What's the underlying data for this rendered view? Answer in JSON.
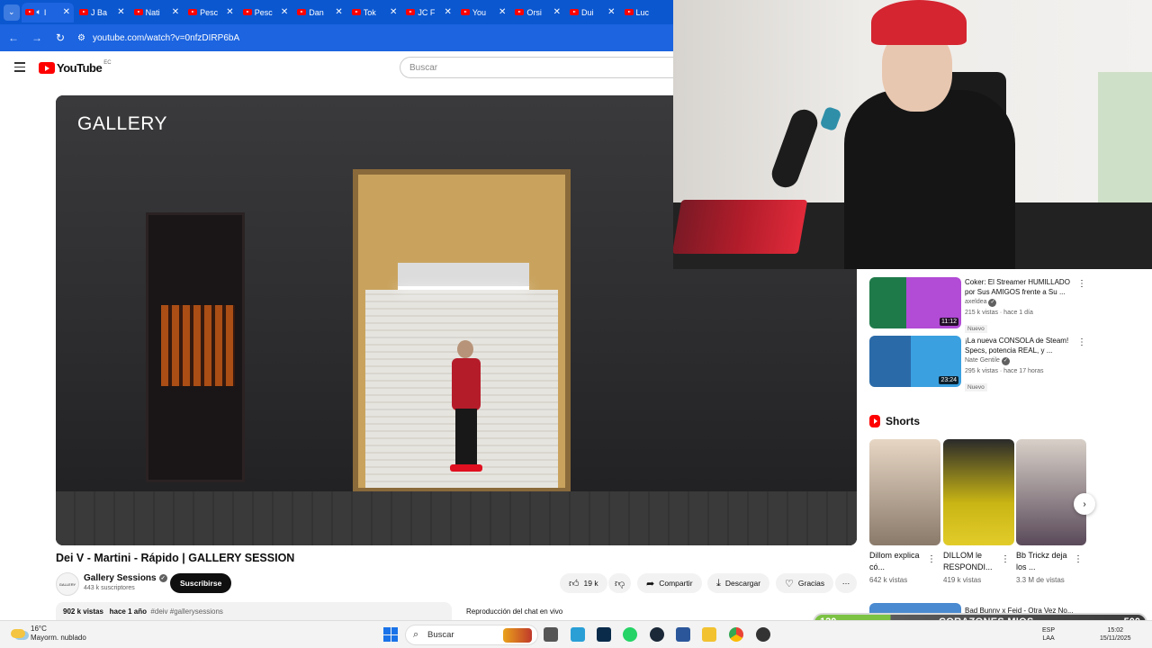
{
  "browser": {
    "tabs": [
      {
        "title": "I",
        "active": true,
        "audio": true
      },
      {
        "title": "J Ba"
      },
      {
        "title": "Nati"
      },
      {
        "title": "Pesc"
      },
      {
        "title": "Pesc"
      },
      {
        "title": "Dan"
      },
      {
        "title": "Tok"
      },
      {
        "title": "JC F"
      },
      {
        "title": "You"
      },
      {
        "title": "Orsi"
      },
      {
        "title": "Dui"
      },
      {
        "title": "Luc"
      }
    ],
    "url": "youtube.com/watch?v=0nfzDIRP6bA"
  },
  "youtube": {
    "logo_text": "YouTube",
    "country_code": "EC",
    "search_placeholder": "Buscar"
  },
  "video": {
    "watermark": "GALLERY",
    "title": "Dei V - Martini - Rápido | GALLERY SESSION",
    "channel": "Gallery Sessions",
    "channel_avatar_text": "GALLERY",
    "subscribers": "443 k suscriptores",
    "subscribe_label": "Suscribirse",
    "likes": "19 k",
    "share_label": "Compartir",
    "download_label": "Descargar",
    "thanks_label": "Gracias",
    "views": "902 k vistas",
    "age": "hace 1 año",
    "tags": "#deiv #gallerysessions",
    "chat_replay": "Reproducción del chat en vivo"
  },
  "sidebar": {
    "recommendations": [
      {
        "title": "Coker: El Streamer HUMILLADO por Sus AMIGOS frente a Su ...",
        "channel": "axeldea",
        "meta": "215 k vistas · hace 1 día",
        "badge": "Nuevo",
        "duration": "11:12",
        "thumb_color": "#b24bd6"
      },
      {
        "title": "¡La nueva CONSOLA de Steam! Specs, potencia REAL, y ...",
        "channel": "Nate Gentile",
        "meta": "295 k vistas · hace 17 horas",
        "badge": "Nuevo",
        "duration": "23:24",
        "thumb_color": "#2f8fd6"
      }
    ],
    "shorts_heading": "Shorts",
    "shorts": [
      {
        "title": "Dillom explica có...",
        "views": "642 k vistas",
        "color": "#8a7a6a"
      },
      {
        "title": "DILLOM le RESPONDI...",
        "views": "419 k vistas",
        "color": "#c9b514"
      },
      {
        "title": "Bb Trickz deja los ...",
        "views": "3.3 M de vistas",
        "color": "#5a4a5a"
      }
    ],
    "next_peek_title": "Bad Bunny x Feid - Otra Vez No..."
  },
  "stream_bar": {
    "left": "120",
    "center": "CORAZONES MIOS",
    "right": "500"
  },
  "taskbar": {
    "temperature": "16°C",
    "weather": "Mayorm. nublado",
    "search_label": "Buscar",
    "language": "ESP",
    "layout": "LAA",
    "time": "15:02",
    "date": "15/11/2025"
  }
}
